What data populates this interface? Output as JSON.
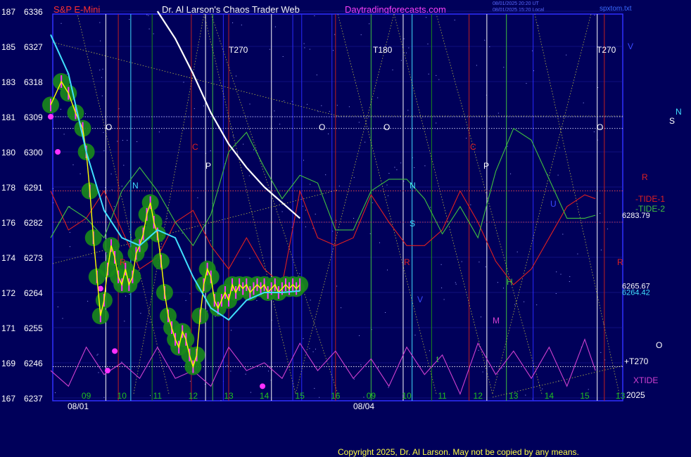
{
  "header": {
    "symbol": "S&P E-Mini",
    "title": "Dr. Al Larson's Chaos Trader Web",
    "site": "Daytradingforecasts.com",
    "stamp1": "08/01/2025 20:20 UT",
    "stamp2": "08/01/2025 15:20 Local",
    "file": "spxtom.txt"
  },
  "footer": {
    "copyright": "Copyright 2025, Dr. Al Larson. May not be copied by any means."
  },
  "colors": {
    "background": "#00005a",
    "plot_border": "#3030ff",
    "bands": "#1a8a1a",
    "price": "#ffff00",
    "bars": "#ff30ff",
    "cyan_avg": "#40e0ff",
    "white_avg": "#ffffff",
    "tide1": "#e02020",
    "tide2": "#40c040",
    "xtide": "#d040d0"
  },
  "chart_data": {
    "type": "line",
    "title": "S&P E-Mini",
    "y_axis_left_labels": [
      {
        "idx": "187",
        "price": "6336"
      },
      {
        "idx": "185",
        "price": "6327"
      },
      {
        "idx": "183",
        "price": "6318"
      },
      {
        "idx": "181",
        "price": "6309"
      },
      {
        "idx": "180",
        "price": "6300"
      },
      {
        "idx": "178",
        "price": "6291"
      },
      {
        "idx": "176",
        "price": "6282"
      },
      {
        "idx": "174",
        "price": "6273"
      },
      {
        "idx": "172",
        "price": "6264"
      },
      {
        "idx": "171",
        "price": "6255"
      },
      {
        "idx": "169",
        "price": "6246"
      },
      {
        "idx": "167",
        "price": "6237"
      }
    ],
    "ylim": [
      6237,
      6336
    ],
    "x_hour_ticks": [
      "09",
      "10",
      "11",
      "12",
      "13",
      "14",
      "15",
      "16",
      "09",
      "10",
      "11",
      "12",
      "13",
      "14",
      "15",
      "13"
    ],
    "x_date_labels": [
      "08/01",
      "08/04"
    ],
    "x_year_label": "2025",
    "series": [
      {
        "name": "price",
        "x": [
          0,
          0.3,
          0.5,
          0.7,
          0.9,
          1.0,
          1.1,
          1.2,
          1.3,
          1.4,
          1.5,
          1.6,
          1.7,
          1.8,
          1.9,
          2.0,
          2.1,
          2.2,
          2.3,
          2.4,
          2.5,
          2.6,
          2.7,
          2.8,
          2.9,
          3.0,
          3.1,
          3.2,
          3.3,
          3.4,
          3.5,
          3.6,
          3.7,
          3.8,
          3.9,
          4.0,
          4.1,
          4.2,
          4.3,
          4.4,
          4.5,
          4.6,
          4.7,
          4.8,
          4.9,
          5.0,
          5.1,
          5.2,
          5.3,
          5.4,
          5.5,
          5.6,
          5.7,
          5.8,
          5.9,
          6.0,
          6.1,
          6.2,
          6.3,
          6.4,
          6.5,
          6.6,
          6.7,
          6.8,
          6.9,
          7.0
        ],
        "values": [
          6312,
          6318,
          6315,
          6310,
          6306,
          6300,
          6290,
          6278,
          6268,
          6258,
          6262,
          6270,
          6276,
          6273,
          6268,
          6266,
          6270,
          6266,
          6268,
          6274,
          6276,
          6279,
          6284,
          6287,
          6282,
          6279,
          6272,
          6264,
          6258,
          6255,
          6252,
          6250,
          6254,
          6252,
          6248,
          6245,
          6248,
          6258,
          6266,
          6270,
          6268,
          6262,
          6260,
          6262,
          6264,
          6262,
          6266,
          6264,
          6266,
          6265,
          6266,
          6264,
          6265,
          6266,
          6265,
          6266,
          6264,
          6265,
          6266,
          6264,
          6265,
          6266,
          6265,
          6266,
          6265,
          6266
        ]
      },
      {
        "name": "cyan",
        "x": [
          0,
          0.5,
          1.0,
          1.5,
          2.0,
          2.5,
          3.0,
          3.5,
          4.0,
          4.5,
          5.0,
          5.5,
          6.0,
          6.5,
          7.0
        ],
        "values": [
          6330,
          6320,
          6300,
          6285,
          6278,
          6276,
          6280,
          6278,
          6268,
          6260,
          6257,
          6262,
          6264,
          6264,
          6264.42
        ]
      },
      {
        "name": "white",
        "x": [
          3.0,
          3.5,
          4.0,
          4.5,
          5.0,
          5.5,
          6.0,
          6.5,
          7.0
        ],
        "values": [
          6336,
          6329,
          6320,
          6310,
          6302,
          6296,
          6291,
          6287,
          6283
        ]
      },
      {
        "name": "-TIDE-1",
        "x": [
          0,
          0.5,
          1.0,
          1.5,
          2.0,
          2.5,
          3.0,
          3.5,
          4.0,
          4.5,
          5.0,
          5.5,
          6.0,
          6.5,
          7.0,
          7.5,
          8.0,
          8.5,
          9.0,
          9.5,
          10.0,
          10.5,
          11.0,
          11.5,
          12.0,
          12.5,
          13.0,
          13.5,
          14.0,
          14.5,
          15.0,
          15.3
        ],
        "values": [
          6290,
          6280,
          6283,
          6290,
          6280,
          6270,
          6273,
          6282,
          6285,
          6276,
          6270,
          6278,
          6270,
          6266,
          6290,
          6278,
          6276,
          6278,
          6289,
          6282,
          6276,
          6276,
          6280,
          6290,
          6282,
          6272,
          6266,
          6270,
          6278,
          6286,
          6289,
          6288
        ]
      },
      {
        "name": "-TIDE-2",
        "x": [
          0,
          0.5,
          1.0,
          1.5,
          2.0,
          2.5,
          3.0,
          3.5,
          4.0,
          4.5,
          5.0,
          5.5,
          6.0,
          6.5,
          7.0,
          7.5,
          8.0,
          8.5,
          9.0,
          9.5,
          10.0,
          10.5,
          11.0,
          11.5,
          12.0,
          12.5,
          13.0,
          13.5,
          14.0,
          14.5,
          15.0,
          15.3
        ],
        "values": [
          6278,
          6286,
          6283,
          6278,
          6290,
          6296,
          6290,
          6282,
          6276,
          6284,
          6300,
          6305,
          6296,
          6288,
          6294,
          6292,
          6280,
          6280,
          6290,
          6293,
          6293,
          6288,
          6279,
          6286,
          6278,
          6295,
          6306,
          6303,
          6293,
          6283,
          6283,
          6283.79
        ]
      },
      {
        "name": "XTIDE",
        "x": [
          0,
          0.5,
          1.0,
          1.5,
          2.0,
          2.5,
          3.0,
          3.5,
          4.0,
          4.5,
          5.0,
          5.5,
          6.0,
          6.5,
          7.0,
          7.5,
          8.0,
          8.5,
          9.0,
          9.5,
          10.0,
          10.5,
          11.0,
          11.5,
          12.0,
          12.5,
          13.0,
          13.5,
          14.0,
          14.5,
          15.0,
          15.3
        ],
        "values": [
          6244,
          6240,
          6250,
          6243,
          6246,
          6242,
          6250,
          6242,
          6244,
          6240,
          6250,
          6244,
          6246,
          6242,
          6251,
          6244,
          6249,
          6242,
          6247,
          6240,
          6250,
          6243,
          6248,
          6238,
          6251,
          6243,
          6249,
          6242,
          6250,
          6240,
          6252,
          6244
        ]
      }
    ],
    "right_values": [
      {
        "label": "6283.79",
        "value": 6283.79
      },
      {
        "label": "6265.67",
        "value": 6265.67
      },
      {
        "label": "6264.42",
        "value": 6264.42
      }
    ],
    "right_legend": [
      "R",
      "-TIDE-1",
      "-TIDE-2",
      "+T270",
      "XTIDE",
      "O",
      "S",
      "N",
      "V"
    ],
    "annotations": [
      "T270",
      "T180",
      "T270",
      "O",
      "O",
      "O",
      "O",
      "N",
      "N",
      "S",
      "C",
      "C",
      "P",
      "P",
      "R",
      "R",
      "R",
      "H",
      "M",
      "V",
      "U",
      "t"
    ]
  }
}
